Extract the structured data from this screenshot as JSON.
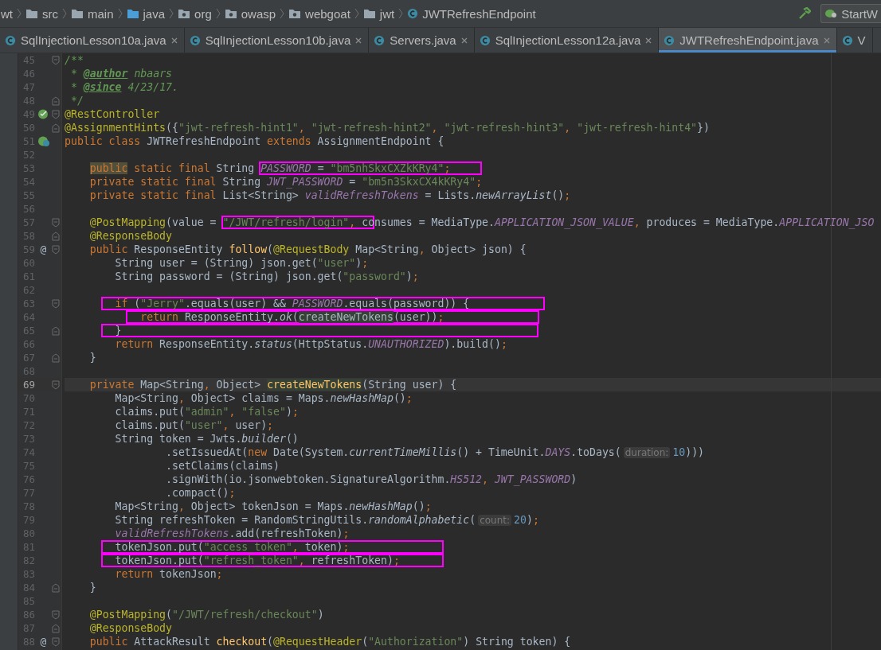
{
  "breadcrumb": {
    "items": [
      {
        "text": "wt"
      },
      {
        "text": "src",
        "kind": "folder"
      },
      {
        "text": "main",
        "kind": "folder"
      },
      {
        "text": "java",
        "kind": "source-folder"
      },
      {
        "text": "org",
        "kind": "package"
      },
      {
        "text": "owasp",
        "kind": "package"
      },
      {
        "text": "webgoat",
        "kind": "package"
      },
      {
        "text": "jwt",
        "kind": "folder"
      },
      {
        "text": "JWTRefreshEndpoint",
        "kind": "class"
      }
    ],
    "run_config": "StartW"
  },
  "tabs": [
    {
      "label": "SqlInjectionLesson10a.java",
      "selected": false,
      "closable": true
    },
    {
      "label": "SqlInjectionLesson10b.java",
      "selected": false,
      "closable": true
    },
    {
      "label": "Servers.java",
      "selected": false,
      "closable": true
    },
    {
      "label": "SqlInjectionLesson12a.java",
      "selected": false,
      "closable": true
    },
    {
      "label": "JWTRefreshEndpoint.java",
      "selected": true,
      "closable": true
    },
    {
      "label": "V",
      "selected": false,
      "closable": false
    }
  ],
  "lines": [
    {
      "number": "45",
      "current": false,
      "fold": {
        "kind": "start"
      },
      "tokens": [
        {
          "kind": "comment",
          "text": "/**"
        }
      ]
    },
    {
      "number": "46",
      "current": false,
      "tokens": [
        {
          "kind": "comment",
          "text": " * "
        },
        {
          "kind": "doctag",
          "text": "@author"
        },
        {
          "kind": "comment",
          "text": " nbaars"
        }
      ]
    },
    {
      "number": "47",
      "current": false,
      "tokens": [
        {
          "kind": "comment",
          "text": " * "
        },
        {
          "kind": "doctag",
          "text": "@since"
        },
        {
          "kind": "comment",
          "text": " 4/23/17."
        }
      ]
    },
    {
      "number": "48",
      "current": false,
      "fold": {
        "kind": "end"
      },
      "tokens": [
        {
          "kind": "comment",
          "text": " */"
        }
      ]
    },
    {
      "number": "49",
      "current": false,
      "fold": {
        "kind": "start"
      },
      "gutter_icon": {
        "kind": "bean"
      },
      "tokens": [
        {
          "kind": "annotation",
          "text": "@RestController"
        }
      ]
    },
    {
      "number": "50",
      "current": false,
      "fold": {
        "kind": "end"
      },
      "tokens": [
        {
          "kind": "annotation",
          "text": "@AssignmentHints"
        },
        {
          "kind": "plain",
          "text": "({"
        },
        {
          "kind": "string",
          "text": "\"jwt-refresh-hint1\""
        },
        {
          "kind": "keyword",
          "text": ", "
        },
        {
          "kind": "string",
          "text": "\"jwt-refresh-hint2\""
        },
        {
          "kind": "keyword",
          "text": ", "
        },
        {
          "kind": "string",
          "text": "\"jwt-refresh-hint3\""
        },
        {
          "kind": "keyword",
          "text": ", "
        },
        {
          "kind": "string",
          "text": "\"jwt-refresh-hint4\""
        },
        {
          "kind": "plain",
          "text": "})"
        }
      ]
    },
    {
      "number": "51",
      "current": false,
      "gutter_icon": {
        "kind": "bean-class"
      },
      "tokens": [
        {
          "kind": "keyword",
          "text": "public class "
        },
        {
          "kind": "plain",
          "text": "JWTRefreshEndpoint "
        },
        {
          "kind": "keyword",
          "text": "extends "
        },
        {
          "kind": "plain",
          "text": "AssignmentEndpoint {"
        }
      ]
    },
    {
      "number": "52",
      "current": false
    },
    {
      "number": "53",
      "current": false,
      "tokens": [
        {
          "kind": "keyword-warning",
          "text": "    public"
        },
        {
          "kind": "keyword",
          "text": " static final "
        },
        {
          "kind": "plain",
          "text": "String "
        },
        {
          "kind": "highlight",
          "tokens": [
            {
              "kind": "field",
              "text": "PASSWORD"
            },
            {
              "kind": "plain",
              "text": " = "
            },
            {
              "kind": "string",
              "text": "\"bm5nhSkxCXZkKRy4\""
            },
            {
              "kind": "keyword",
              "text": ";     "
            }
          ]
        }
      ]
    },
    {
      "number": "54",
      "current": false,
      "tokens": [
        {
          "kind": "keyword",
          "text": "    private static final "
        },
        {
          "kind": "plain",
          "text": "String "
        },
        {
          "kind": "field",
          "text": "JWT_PASSWORD"
        },
        {
          "kind": "plain",
          "text": " = "
        },
        {
          "kind": "string",
          "text": "\"bm5n3SkxCX4kKRy4\""
        },
        {
          "kind": "keyword",
          "text": ";"
        }
      ]
    },
    {
      "number": "55",
      "current": false,
      "tokens": [
        {
          "kind": "keyword",
          "text": "    private static final "
        },
        {
          "kind": "plain",
          "text": "List<String> "
        },
        {
          "kind": "field",
          "text": "validRefreshTokens"
        },
        {
          "kind": "plain",
          "text": " = Lists."
        },
        {
          "kind": "static",
          "text": "newArrayList"
        },
        {
          "kind": "plain",
          "text": "()"
        },
        {
          "kind": "keyword",
          "text": ";"
        }
      ]
    },
    {
      "number": "56",
      "current": false
    },
    {
      "number": "57",
      "current": false,
      "fold": {
        "kind": "start"
      },
      "tokens": [
        {
          "kind": "annotation",
          "text": "    @PostMapping"
        },
        {
          "kind": "plain",
          "text": "(value = "
        },
        {
          "kind": "highlight",
          "tokens": [
            {
              "kind": "string",
              "text": "\"/JWT/refresh/login\""
            },
            {
              "kind": "keyword",
              "text": ", "
            },
            {
              "kind": "plain",
              "text": "co"
            }
          ]
        },
        {
          "kind": "plain",
          "text": "nsumes = MediaType."
        },
        {
          "kind": "field",
          "text": "APPLICATION_JSON_VALUE"
        },
        {
          "kind": "keyword",
          "text": ", "
        },
        {
          "kind": "plain",
          "text": "produces = MediaType."
        },
        {
          "kind": "field",
          "text": "APPLICATION_JSO"
        }
      ]
    },
    {
      "number": "58",
      "current": false,
      "fold": {
        "kind": "end"
      },
      "tokens": [
        {
          "kind": "annotation",
          "text": "    @ResponseBody"
        }
      ]
    },
    {
      "number": "59",
      "current": false,
      "fold": {
        "kind": "start"
      },
      "gutter_text": "@",
      "tokens": [
        {
          "kind": "keyword",
          "text": "    public "
        },
        {
          "kind": "plain",
          "text": "ResponseEntity "
        },
        {
          "kind": "method",
          "text": "follow"
        },
        {
          "kind": "plain",
          "text": "("
        },
        {
          "kind": "annotation",
          "text": "@RequestBody"
        },
        {
          "kind": "plain",
          "text": " Map<String"
        },
        {
          "kind": "keyword",
          "text": ", "
        },
        {
          "kind": "plain",
          "text": "Object> json) {"
        }
      ]
    },
    {
      "number": "60",
      "current": false,
      "tokens": [
        {
          "kind": "plain",
          "text": "        String user = (String) json.get("
        },
        {
          "kind": "string",
          "text": "\"user\""
        },
        {
          "kind": "plain",
          "text": ")"
        },
        {
          "kind": "keyword",
          "text": ";"
        }
      ]
    },
    {
      "number": "61",
      "current": false,
      "tokens": [
        {
          "kind": "plain",
          "text": "        String password = (String) json.get("
        },
        {
          "kind": "string",
          "text": "\"password\""
        },
        {
          "kind": "plain",
          "text": ")"
        },
        {
          "kind": "keyword",
          "text": ";"
        }
      ]
    },
    {
      "number": "62",
      "current": false
    },
    {
      "number": "63",
      "current": false,
      "fold": {
        "kind": "start"
      },
      "tokens": [
        {
          "kind": "highlight",
          "tokens": [
            {
              "kind": "keyword",
              "text": "        if "
            },
            {
              "kind": "plain",
              "text": "("
            },
            {
              "kind": "string",
              "text": "\"Jerry\""
            },
            {
              "kind": "plain",
              "text": ".equals(user) && "
            },
            {
              "kind": "field",
              "text": "PASSWORD"
            },
            {
              "kind": "plain",
              "text": ".equals(password)) {            "
            }
          ]
        }
      ]
    },
    {
      "number": "64",
      "current": false,
      "tokens": [
        {
          "kind": "highlight",
          "tokens": [
            {
              "kind": "keyword",
              "text": "            return "
            },
            {
              "kind": "plain",
              "text": "ResponseEntity."
            },
            {
              "kind": "static",
              "text": "ok"
            },
            {
              "kind": "plain",
              "text": "("
            },
            {
              "kind": "usage",
              "text": "createNewTokens"
            },
            {
              "kind": "plain",
              "text": "(user))"
            },
            {
              "kind": "keyword",
              "text": ";               "
            }
          ]
        }
      ]
    },
    {
      "number": "65",
      "current": false,
      "fold": {
        "kind": "end"
      },
      "tokens": [
        {
          "kind": "highlight",
          "tokens": [
            {
              "kind": "plain",
              "text": "        }                                                                  "
            }
          ]
        }
      ]
    },
    {
      "number": "66",
      "current": false,
      "tokens": [
        {
          "kind": "keyword",
          "text": "        return "
        },
        {
          "kind": "plain",
          "text": "ResponseEntity."
        },
        {
          "kind": "static",
          "text": "status"
        },
        {
          "kind": "plain",
          "text": "(HttpStatus."
        },
        {
          "kind": "field",
          "text": "UNAUTHORIZED"
        },
        {
          "kind": "plain",
          "text": ").build()"
        },
        {
          "kind": "keyword",
          "text": ";"
        }
      ]
    },
    {
      "number": "67",
      "current": false,
      "fold": {
        "kind": "end"
      },
      "tokens": [
        {
          "kind": "plain",
          "text": "    }"
        }
      ]
    },
    {
      "number": "68",
      "current": false
    },
    {
      "number": "69",
      "current": true,
      "fold": {
        "kind": "start"
      },
      "tokens": [
        {
          "kind": "keyword",
          "text": "    private "
        },
        {
          "kind": "plain",
          "text": "Map<String"
        },
        {
          "kind": "keyword",
          "text": ", "
        },
        {
          "kind": "plain",
          "text": "Object> "
        },
        {
          "kind": "usage-method",
          "text": "createNewTokens"
        },
        {
          "kind": "plain",
          "text": "(String user) {"
        }
      ]
    },
    {
      "number": "70",
      "current": false,
      "tokens": [
        {
          "kind": "plain",
          "text": "        Map<String"
        },
        {
          "kind": "keyword",
          "text": ", "
        },
        {
          "kind": "plain",
          "text": "Object> claims = Maps."
        },
        {
          "kind": "static",
          "text": "newHashMap"
        },
        {
          "kind": "plain",
          "text": "()"
        },
        {
          "kind": "keyword",
          "text": ";"
        }
      ]
    },
    {
      "number": "71",
      "current": false,
      "tokens": [
        {
          "kind": "plain",
          "text": "        claims.put("
        },
        {
          "kind": "string",
          "text": "\"admin\""
        },
        {
          "kind": "keyword",
          "text": ", "
        },
        {
          "kind": "string",
          "text": "\"false\""
        },
        {
          "kind": "plain",
          "text": ")"
        },
        {
          "kind": "keyword",
          "text": ";"
        }
      ]
    },
    {
      "number": "72",
      "current": false,
      "tokens": [
        {
          "kind": "plain",
          "text": "        claims.put("
        },
        {
          "kind": "string",
          "text": "\"user\""
        },
        {
          "kind": "keyword",
          "text": ", "
        },
        {
          "kind": "plain",
          "text": "user)"
        },
        {
          "kind": "keyword",
          "text": ";"
        }
      ]
    },
    {
      "number": "73",
      "current": false,
      "tokens": [
        {
          "kind": "plain",
          "text": "        String token = Jwts."
        },
        {
          "kind": "static",
          "text": "builder"
        },
        {
          "kind": "plain",
          "text": "()"
        }
      ]
    },
    {
      "number": "74",
      "current": false,
      "tokens": [
        {
          "kind": "plain",
          "text": "                .setIssuedAt("
        },
        {
          "kind": "keyword",
          "text": "new "
        },
        {
          "kind": "plain",
          "text": "Date(System."
        },
        {
          "kind": "static",
          "text": "currentTimeMillis"
        },
        {
          "kind": "plain",
          "text": "() + TimeUnit."
        },
        {
          "kind": "field",
          "text": "DAYS"
        },
        {
          "kind": "plain",
          "text": ".toDays("
        },
        {
          "kind": "hint",
          "text": "duration:"
        },
        {
          "kind": "number",
          "text": "10"
        },
        {
          "kind": "plain",
          "text": ")))"
        }
      ]
    },
    {
      "number": "75",
      "current": false,
      "tokens": [
        {
          "kind": "plain",
          "text": "                .setClaims(claims)"
        }
      ]
    },
    {
      "number": "76",
      "current": false,
      "tokens": [
        {
          "kind": "plain",
          "text": "                .signWith(io.jsonwebtoken.SignatureAlgorithm."
        },
        {
          "kind": "field",
          "text": "HS512"
        },
        {
          "kind": "keyword",
          "text": ", "
        },
        {
          "kind": "field",
          "text": "JWT_PASSWORD"
        },
        {
          "kind": "plain",
          "text": ")"
        }
      ]
    },
    {
      "number": "77",
      "current": false,
      "tokens": [
        {
          "kind": "plain",
          "text": "                .compact()"
        },
        {
          "kind": "keyword",
          "text": ";"
        }
      ]
    },
    {
      "number": "78",
      "current": false,
      "tokens": [
        {
          "kind": "plain",
          "text": "        Map<String"
        },
        {
          "kind": "keyword",
          "text": ", "
        },
        {
          "kind": "plain",
          "text": "Object> tokenJson = Maps."
        },
        {
          "kind": "static",
          "text": "newHashMap"
        },
        {
          "kind": "plain",
          "text": "()"
        },
        {
          "kind": "keyword",
          "text": ";"
        }
      ]
    },
    {
      "number": "79",
      "current": false,
      "tokens": [
        {
          "kind": "plain",
          "text": "        String refreshToken = RandomStringUtils."
        },
        {
          "kind": "static",
          "text": "randomAlphabetic"
        },
        {
          "kind": "plain",
          "text": "("
        },
        {
          "kind": "hint",
          "text": "count:"
        },
        {
          "kind": "number",
          "text": "20"
        },
        {
          "kind": "plain",
          "text": ")"
        },
        {
          "kind": "keyword",
          "text": ";"
        }
      ]
    },
    {
      "number": "80",
      "current": false,
      "tokens": [
        {
          "kind": "field",
          "text": "        validRefreshTokens"
        },
        {
          "kind": "plain",
          "text": ".add(refreshToken)"
        },
        {
          "kind": "keyword",
          "text": ";"
        }
      ]
    },
    {
      "number": "81",
      "current": false,
      "tokens": [
        {
          "kind": "highlight",
          "tokens": [
            {
              "kind": "plain",
              "text": "        tokenJson.put("
            },
            {
              "kind": "string",
              "text": "\"access_token\""
            },
            {
              "kind": "keyword",
              "text": ", "
            },
            {
              "kind": "plain",
              "text": "token)"
            },
            {
              "kind": "keyword",
              "text": ";               "
            }
          ]
        }
      ]
    },
    {
      "number": "82",
      "current": false,
      "tokens": [
        {
          "kind": "highlight",
          "tokens": [
            {
              "kind": "plain",
              "text": "        tokenJson.put("
            },
            {
              "kind": "string",
              "text": "\"refresh_token\""
            },
            {
              "kind": "keyword",
              "text": ", "
            },
            {
              "kind": "plain",
              "text": "refreshToken)"
            },
            {
              "kind": "keyword",
              "text": ";       "
            }
          ]
        }
      ]
    },
    {
      "number": "83",
      "current": false,
      "tokens": [
        {
          "kind": "keyword",
          "text": "        return "
        },
        {
          "kind": "plain",
          "text": "tokenJson"
        },
        {
          "kind": "keyword",
          "text": ";"
        }
      ]
    },
    {
      "number": "84",
      "current": false,
      "fold": {
        "kind": "end"
      },
      "tokens": [
        {
          "kind": "plain",
          "text": "    }"
        }
      ]
    },
    {
      "number": "85",
      "current": false
    },
    {
      "number": "86",
      "current": false,
      "fold": {
        "kind": "start"
      },
      "tokens": [
        {
          "kind": "annotation",
          "text": "    @PostMapping"
        },
        {
          "kind": "plain",
          "text": "("
        },
        {
          "kind": "string",
          "text": "\"/JWT/refresh/checkout\""
        },
        {
          "kind": "plain",
          "text": ")"
        }
      ]
    },
    {
      "number": "87",
      "current": false,
      "fold": {
        "kind": "end"
      },
      "tokens": [
        {
          "kind": "annotation",
          "text": "    @ResponseBody"
        }
      ]
    },
    {
      "number": "88",
      "current": false,
      "fold": {
        "kind": "start"
      },
      "gutter_text": "@",
      "tokens": [
        {
          "kind": "keyword",
          "text": "    public "
        },
        {
          "kind": "plain",
          "text": "AttackResult "
        },
        {
          "kind": "method",
          "text": "checkout"
        },
        {
          "kind": "plain",
          "text": "("
        },
        {
          "kind": "annotation",
          "text": "@RequestHeader"
        },
        {
          "kind": "plain",
          "text": "("
        },
        {
          "kind": "string",
          "text": "\"Authorization\""
        },
        {
          "kind": "plain",
          "text": ") String token) {"
        }
      ]
    }
  ]
}
